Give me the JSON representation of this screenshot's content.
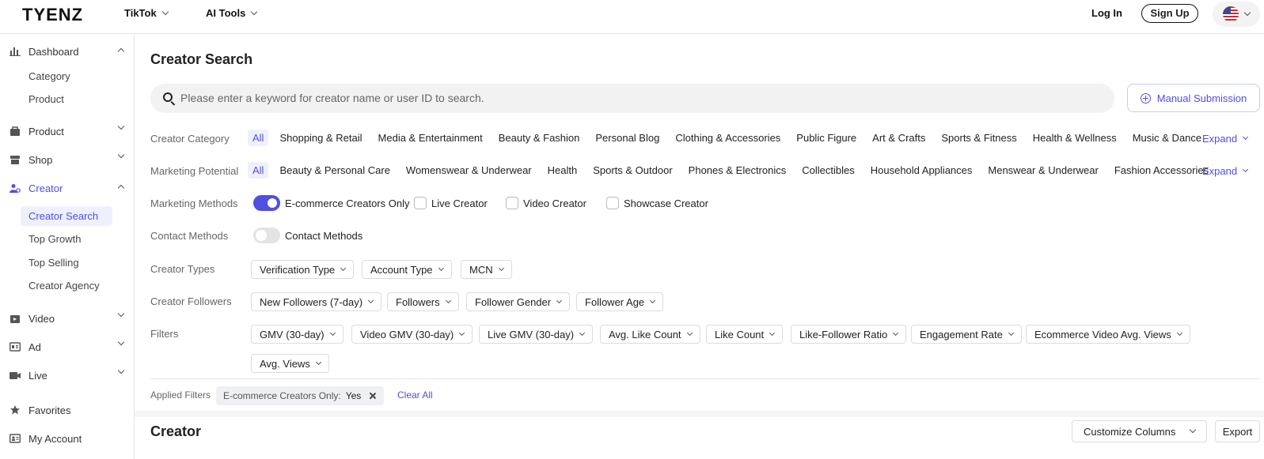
{
  "header": {
    "logo": "TYENZ",
    "nav": [
      {
        "label": "TikTok"
      },
      {
        "label": "AI Tools"
      }
    ],
    "login_label": "Log In",
    "signup_label": "Sign Up",
    "language_icon": "us-flag-icon"
  },
  "sidebar": {
    "groups": [
      {
        "label": "Dashboard",
        "icon": "bar-chart-icon",
        "expanded": true,
        "items": [
          "Category",
          "Product"
        ]
      },
      {
        "label": "Product",
        "icon": "bag-icon",
        "expanded": false
      },
      {
        "label": "Shop",
        "icon": "shop-icon",
        "expanded": false
      },
      {
        "label": "Creator",
        "icon": "creator-icon",
        "expanded": true,
        "items": [
          "Creator Search",
          "Top Growth",
          "Top Selling",
          "Creator Agency"
        ]
      },
      {
        "label": "Video",
        "icon": "video-icon",
        "expanded": false
      },
      {
        "label": "Ad",
        "icon": "ad-icon",
        "expanded": false
      },
      {
        "label": "Live",
        "icon": "live-icon",
        "expanded": false
      }
    ],
    "bottom": [
      {
        "label": "Favorites",
        "icon": "star-icon"
      },
      {
        "label": "My Account",
        "icon": "account-icon"
      }
    ],
    "active_item": "Creator Search",
    "accent": "#4f4fe0"
  },
  "main": {
    "title": "Creator Search",
    "search_placeholder": "Please enter a keyword for creator name or user ID to search.",
    "manual_submission_label": "Manual Submission",
    "creator_category": {
      "label": "Creator Category",
      "options": [
        "All",
        "Shopping & Retail",
        "Media & Entertainment",
        "Beauty & Fashion",
        "Personal Blog",
        "Clothing & Accessories",
        "Public Figure",
        "Art & Crafts",
        "Sports & Fitness",
        "Health & Wellness",
        "Music & Dance"
      ],
      "selected": "All",
      "expand_label": "Expand"
    },
    "marketing_potential": {
      "label": "Marketing Potential",
      "options": [
        "All",
        "Beauty & Personal Care",
        "Womenswear & Underwear",
        "Health",
        "Sports & Outdoor",
        "Phones & Electronics",
        "Collectibles",
        "Household Appliances",
        "Menswear & Underwear",
        "Fashion Accessories"
      ],
      "selected": "All",
      "expand_label": "Expand"
    },
    "marketing_methods": {
      "label": "Marketing Methods",
      "toggle_label": "E-commerce Creators Only",
      "toggle_on": true,
      "checkboxes": [
        "Live Creator",
        "Video Creator",
        "Showcase Creator"
      ]
    },
    "contact_methods": {
      "label": "Contact Methods",
      "toggle_label": "Contact Methods",
      "toggle_on": false
    },
    "creator_types": {
      "label": "Creator Types",
      "dropdowns": [
        "Verification Type",
        "Account Type",
        "MCN"
      ]
    },
    "creator_followers": {
      "label": "Creator Followers",
      "dropdowns": [
        "New Followers (7-day)",
        "Followers",
        "Follower Gender",
        "Follower Age"
      ]
    },
    "filters": {
      "label": "Filters",
      "dropdowns": [
        "GMV (30-day)",
        "Video GMV (30-day)",
        "Live GMV (30-day)",
        "Avg. Like Count",
        "Like Count",
        "Like-Follower Ratio",
        "Engagement Rate",
        "Ecommerce Video Avg. Views",
        "Avg. Views"
      ]
    },
    "applied_filters": {
      "label": "Applied Filters",
      "tag_key": "E-commerce Creators Only:",
      "tag_value": "Yes",
      "clear_label": "Clear All"
    },
    "creator_section": {
      "title": "Creator",
      "customize_label": "Customize Columns",
      "export_label": "Export"
    }
  }
}
